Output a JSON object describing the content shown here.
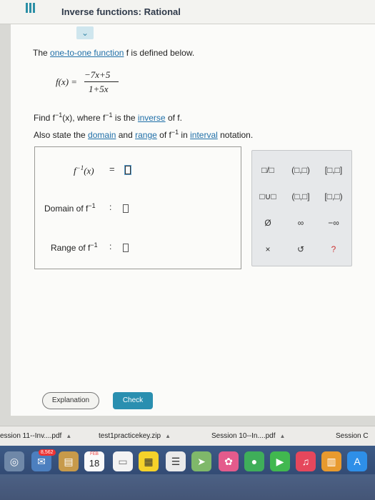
{
  "header": {
    "title": "Inverse functions: Rational",
    "menu_icon": "hamburger-icon"
  },
  "collapse_toggle": "⌄",
  "problem": {
    "intro_prefix": "The ",
    "intro_link": "one-to-one function",
    "intro_suffix": " f is defined below.",
    "fx_lhs": "f(x) =",
    "fx_numerator": "−7x+5",
    "fx_denominator": "1+5x",
    "find_prefix": "Find f",
    "find_sup": "−1",
    "find_mid": "(x), where f",
    "find_mid_sup": "−1",
    "find_mid2": " is the ",
    "find_link": "inverse",
    "find_suffix": " of f.",
    "also_prefix": "Also state the ",
    "also_link1": "domain",
    "also_mid": " and ",
    "also_link2": "range",
    "also_mid2": " of f",
    "also_sup": "−1",
    "also_mid3": " in ",
    "also_link3": "interval",
    "also_suffix": " notation."
  },
  "answer": {
    "inverse_label": "f",
    "inverse_sup": "−1",
    "inverse_arg": "(x)",
    "equals": "=",
    "domain_label": "Domain of f",
    "domain_sup": "−1",
    "range_label": "Range of f",
    "range_sup": "−1",
    "colon": ":"
  },
  "palette": {
    "keys": [
      [
        "□/□",
        "(□,□)",
        "[□,□]"
      ],
      [
        "□∪□",
        "(□,□]",
        "[□,□)"
      ],
      [
        "Ø",
        "∞",
        "−∞"
      ],
      [
        "×",
        "↺",
        "?"
      ]
    ]
  },
  "buttons": {
    "explanation": "Explanation",
    "check": "Check"
  },
  "downloads": [
    {
      "label": "ession 11--Inv....pdf"
    },
    {
      "label": "test1practicekey.zip"
    },
    {
      "label": "Session 10--In....pdf"
    },
    {
      "label": "Session C"
    }
  ],
  "dock": {
    "badge": "8,562",
    "calendar_month": "FEB",
    "calendar_day": "18"
  }
}
